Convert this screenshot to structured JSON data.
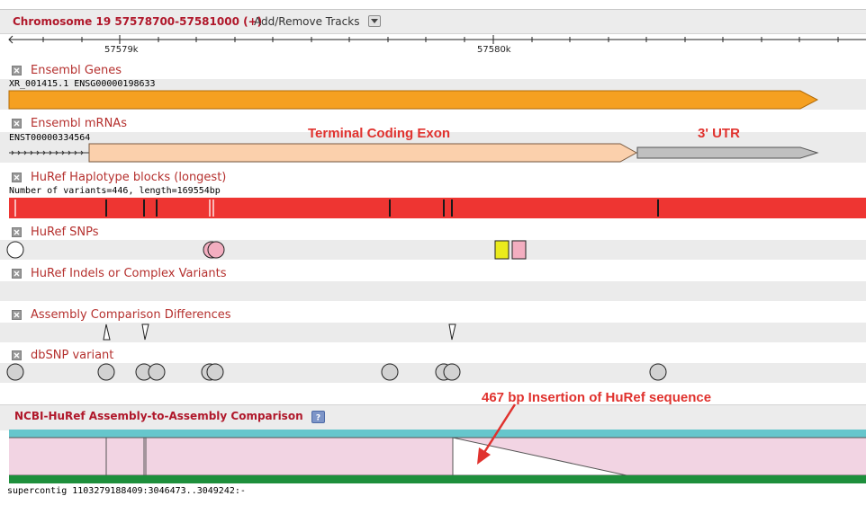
{
  "header": {
    "title": "Chromosome 19 57578700-57581000 (+)",
    "add_remove": "Add/Remove Tracks"
  },
  "ruler": {
    "label_left": "57579k",
    "label_right": "57580k"
  },
  "tracks": {
    "ensembl_genes": {
      "title": "Ensembl Genes",
      "feature_label": "XR_001415.1 ENSG00000198633"
    },
    "ensembl_mrnas": {
      "title": "Ensembl mRNAs",
      "feature_label": "ENST00000334564"
    },
    "haplotype": {
      "title": "HuRef Haplotype blocks (longest)",
      "feature_label": "Number of variants=446, length=169554bp"
    },
    "snps": {
      "title": "HuRef SNPs"
    },
    "indels": {
      "title": "HuRef Indels or Complex Variants"
    },
    "assembly_diff": {
      "title": "Assembly Comparison Differences"
    },
    "dbsnp": {
      "title": "dbSNP variant"
    }
  },
  "annotations": {
    "coding_exon": "Terminal Coding Exon",
    "utr": "3' UTR",
    "insertion": "467 bp Insertion of HuRef sequence"
  },
  "comparison": {
    "title": "NCBI-HuRef Assembly-to-Assembly Comparison",
    "help_icon": "help-icon",
    "footer": "supercontig 1103279188409:3046473..3049242:-"
  },
  "colors": {
    "gene": "#f5a021",
    "mrna_exon": "#fbd0ac",
    "utr": "#c0c0c0",
    "haplotype": "#ee3532",
    "snp_pink": "#f3aec0",
    "snp_yellow": "#eaea1c",
    "alignment": "#f2d4e3",
    "teal": "#66c6cc",
    "green": "#1e8f3c",
    "title_red": "#b0182b"
  }
}
